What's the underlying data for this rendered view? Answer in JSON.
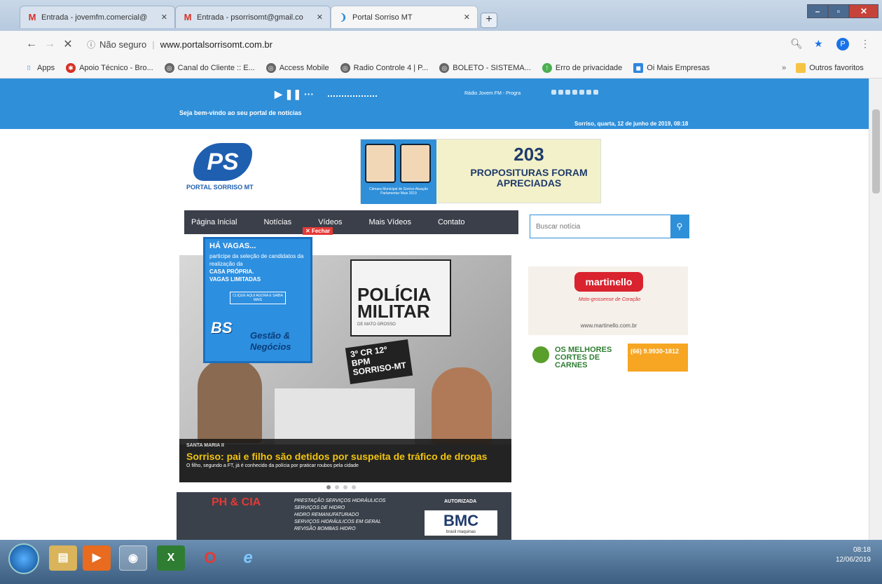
{
  "browser": {
    "tabs": [
      {
        "label": "Entrada - jovemfm.comercial@",
        "icon": "gmail-icon"
      },
      {
        "label": "Entrada - psorrisomt@gmail.co",
        "icon": "gmail-icon"
      },
      {
        "label": "Portal Sorriso MT",
        "icon": "loading-icon"
      }
    ],
    "address_security": "Não seguro",
    "address_url": "www.portalsorrisomt.com.br",
    "bookmarks": [
      {
        "label": "Apps"
      },
      {
        "label": "Apoio Técnico - Bro..."
      },
      {
        "label": "Canal do Cliente :: E..."
      },
      {
        "label": "Access Mobile"
      },
      {
        "label": "Radio Controle 4 | P..."
      },
      {
        "label": "BOLETO - SISTEMA..."
      },
      {
        "label": "Erro de privacidade"
      },
      {
        "label": "Oi Mais Empresas"
      }
    ],
    "other_bookmarks": "Outros favoritos",
    "profile_initial": "P"
  },
  "topbar": {
    "welcome": "Seja bem-vindo ao seu portal de notícias",
    "date": "Sorriso, quarta, 12 de junho de 2019, 08:18",
    "radio": "Rádio Jovem FM - Progra"
  },
  "logo": {
    "initials": "PS",
    "name": "PORTAL SORRISO MT"
  },
  "banner": {
    "number": "203",
    "text": "PROPOSITURAS FORAM APRECIADAS",
    "caption": "Câmara Municipal de Sorriso Atuação Parlamentar Mais 2019"
  },
  "nav": [
    "Página Inicial",
    "Notícias",
    "Vídeos",
    "Mais Vídeos",
    "Contato"
  ],
  "fechar": "Fechar",
  "search": {
    "placeholder": "Buscar notícia"
  },
  "popup": {
    "title": "HÁ VAGAS...",
    "body": "participe da seleção de candidatos da realização da",
    "highlight1": "CASA PRÓPRIA.",
    "highlight2": "VAGAS LIMITADAS",
    "cta": "CLIQUE AQUI AGORA E SAIBA MAIS",
    "brand": "Gestão & Negócios"
  },
  "slide": {
    "board": "POLÍCIA MILITAR",
    "board_sub": "DE MATO GROSSO",
    "plate": "3º CR 12º BPM SORRISO-MT",
    "kicker": "SANTA MARIA II",
    "headline": "Sorriso: pai e filho são detidos por suspeita de tráfico de drogas",
    "sub": "O filho, segundo a FT, já é conhecido da polícia por praticar roubos pela cidade"
  },
  "ads": {
    "martinello": {
      "logo": "martinello",
      "tag": "Moto-grossense de Coração",
      "web": "www.martinello.com.br"
    },
    "carnes": {
      "text": "OS MELHORES CORTES DE CARNES",
      "phone": "(66) 9.9930-1812"
    },
    "bottom": {
      "brand": "PH & CIA",
      "services": [
        "PRESTAÇÃO SERVIÇOS HIDRÁULICOS",
        "SERVIÇOS DE HIDRO",
        "HIDRO REMANUFATURADO",
        "SERVIÇOS HIDRÁULICOS EM GERAL",
        "REVISÃO BOMBAS HIDRO"
      ],
      "authorized": "AUTORIZADA",
      "partner": "BMC",
      "partner_sub": "brasil maquinas"
    }
  },
  "taskbar": {
    "time": "08:18",
    "date": "12/06/2019"
  }
}
